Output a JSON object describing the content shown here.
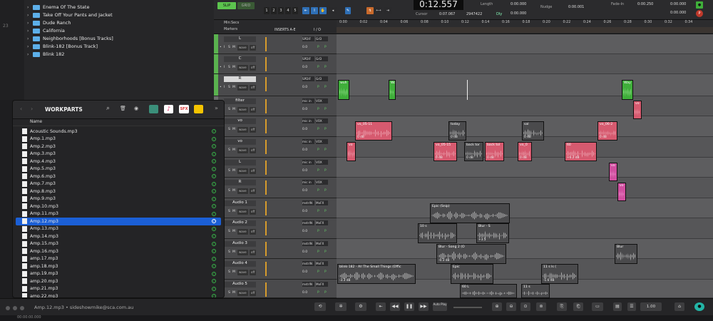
{
  "background_finder": {
    "folders": [
      "Enema Of The State",
      "Take Off Your Pants and Jacket",
      "Dude Ranch",
      "California",
      "Neighborhoods [Bonus Tracks]",
      "Blink-182 [Bonus Track]",
      "Blink 182"
    ],
    "gutter_number": "23"
  },
  "protools": {
    "modes": {
      "slip": "SLIP",
      "grid": "GRID"
    },
    "zoom_presets": [
      "1",
      "2",
      "3",
      "4",
      "5"
    ],
    "counter": {
      "main": "0:12.557",
      "length_label": "Length",
      "cursor_label": "Cursor",
      "cursor_value": "0:07.067",
      "samples": "2947422",
      "dly": "Dly",
      "length_value": "0:00.000",
      "grid_value": "0:00.000",
      "nudge_label": "Nudge",
      "nudge_value": "0:00.001"
    },
    "fade_in": {
      "label": "Fade-In",
      "value": "0:00.250"
    },
    "time_right": {
      "label1": "0:00.000",
      "label2": "0:00.000"
    },
    "ruler_labels": {
      "min_secs": "Min:Secs",
      "markers": "Markers"
    },
    "ruler_ticks": [
      "0:00",
      "0:02",
      "0:04",
      "0:06",
      "0:08",
      "0:10",
      "0:12",
      "0:14",
      "0:16",
      "0:18",
      "0:20",
      "0:22",
      "0:24",
      "0:26",
      "0:28",
      "0:30",
      "0:32",
      "0:34"
    ],
    "col_headers": {
      "inserts": "INSERTS A-E",
      "io": "I / O"
    },
    "tracks": [
      {
        "name": "L",
        "io1": "SPDIF",
        "io2": "GrD",
        "vol": "0.0",
        "pan": "P",
        "type": "inst"
      },
      {
        "name": "C",
        "io1": "SPDIF",
        "io2": "GrD",
        "vol": "0.0",
        "pan": "P",
        "type": "inst"
      },
      {
        "name": "R",
        "io1": "SPDIF",
        "io2": "GrD",
        "vol": "0.0",
        "pan": "P",
        "type": "inst"
      },
      {
        "name": "filter",
        "io1": "mic in",
        "io2": "VOX",
        "vol": "0.0",
        "pan": "P",
        "type": "aud"
      },
      {
        "name": "vo",
        "io1": "mic in",
        "io2": "VOX",
        "vol": "0.0",
        "pan": "P",
        "type": "aud"
      },
      {
        "name": "vo",
        "io1": "mic in",
        "io2": "VOX",
        "vol": "0.0",
        "pan": "P",
        "type": "aud"
      },
      {
        "name": "L",
        "io1": "mic in",
        "io2": "VOX",
        "vol": "0.0",
        "pan": "P",
        "type": "aud"
      },
      {
        "name": "R",
        "io1": "mic in",
        "io2": "VOX",
        "vol": "0.0",
        "pan": "P",
        "type": "aud"
      },
      {
        "name": "Audio 1",
        "io1": "mstrIN",
        "io2": "MxFX",
        "vol": "0.0",
        "pan": "P",
        "type": "aud"
      },
      {
        "name": "Audio 2",
        "io1": "mstrIN",
        "io2": "MxFX",
        "vol": "0.0",
        "pan": "P",
        "type": "aud"
      },
      {
        "name": "Audio 3",
        "io1": "mstrIN",
        "io2": "MxFX",
        "vol": "0.0",
        "pan": "P",
        "type": "aud"
      },
      {
        "name": "Audio 4",
        "io1": "mstrIN",
        "io2": "MxFX",
        "vol": "0.0",
        "pan": "P",
        "type": "aud"
      },
      {
        "name": "Audio 5",
        "io1": "mstrIN",
        "io2": "MxFX",
        "vol": "0.0",
        "pan": "P",
        "type": "aud"
      }
    ],
    "track_controls": {
      "rec": "•",
      "input": "I",
      "solo": "S",
      "mute": "M",
      "wave": "wave",
      "off": "off",
      "power": "◉"
    },
    "clip_labels": {
      "wuh": "wuh",
      "wo": "Wo",
      "way": "Way",
      "vo_top": "vo",
      "vo_05_11": "vo_05-11",
      "today": "today",
      "sal": "sal",
      "vo_06_2": "vo_06-2",
      "vo_a": "vo",
      "vo_05_15": "vo_05-15",
      "back_tor": "back tor",
      "back_tol": "back tol",
      "vo_0": "vo_0",
      "c60": "60",
      "vo_l": "vo",
      "vo_l2": "vo",
      "vo_r": "vo",
      "vo_r2": "vo",
      "epic": "Epic (Snip)",
      "x10": "10 s",
      "blur5": "Blur - S",
      "blur5_gain": "+3.5",
      "blur": "Blur",
      "blur_song": "Blur - Song 2 (O",
      "blur_song_gain": "-0.3 dB",
      "blink": "blink-182 - All The Small Things (Offic",
      "blink_gain": "-3.3 dB",
      "epic2": "Epic",
      "eleven": "11 s ls (",
      "sixty": "60 L",
      "eleven2": "11 s",
      "gain0": "0 dB",
      "gain_plus": "+6.2 dB",
      "gain_minus": "-1.6 dB"
    }
  },
  "workparts": {
    "title": "WORKPARTS",
    "column": "Name",
    "files": [
      "Acoustic Sounds.mp3",
      "Amp.1.mp3",
      "Amp.2.mp3",
      "Amp.3.mp3",
      "Amp.4.mp3",
      "Amp.5.mp3",
      "Amp.6.mp3",
      "Amp.7.mp3",
      "Amp.8.mp3",
      "Amp.9.mp3",
      "Amp.10.mp3",
      "Amp.11.mp3",
      "Amp.12.mp3",
      "Amp.13.mp3",
      "Amp.14.mp3",
      "Amp.15.mp3",
      "Amp.16.mp3",
      "amp.17.mp3",
      "amp.18.mp3",
      "amp.19.mp3",
      "amp.20.mp3",
      "amp.21.mp3",
      "amp.22.mp3"
    ],
    "selected_index": 12,
    "tool_sfx": "SFX"
  },
  "status": {
    "text": "Amp.12.mp3 • sideshowmike@sca.com.au",
    "autoplay": "Auto Play",
    "zoom_value": "1.00",
    "bottom_time": "00:00:00.000"
  },
  "colors": {
    "selected": "#1b5fd6",
    "check": "#39b54a",
    "vocal_clip": "#d65a6f",
    "inst_clip": "#3fae3a",
    "pink_clip": "#d14fa0",
    "audio_clip": "#4a4a4c"
  }
}
